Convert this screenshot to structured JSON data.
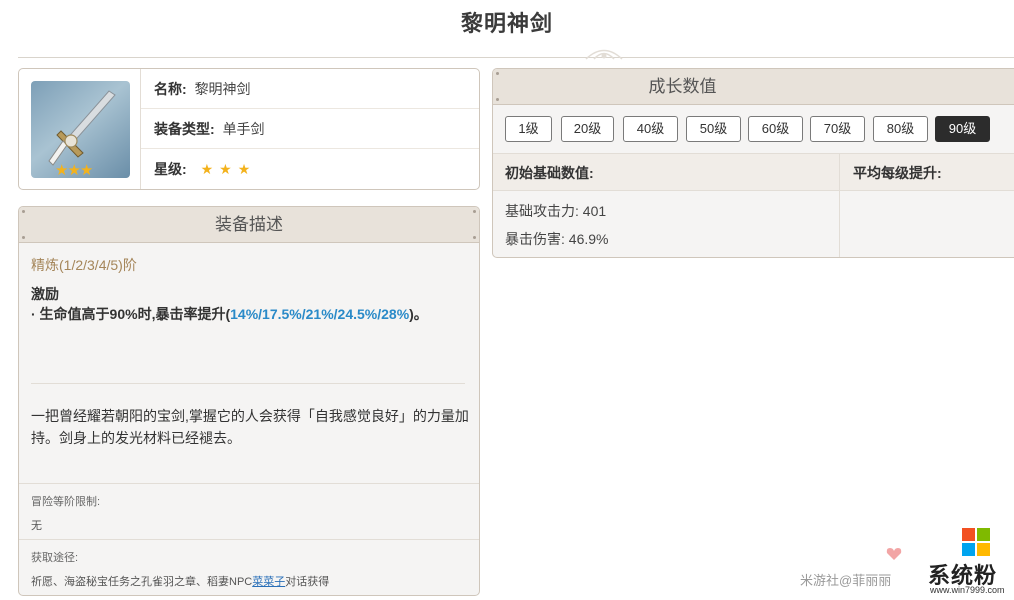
{
  "page": {
    "title": "黎明神剑"
  },
  "info": {
    "rows": [
      {
        "label": "名称:",
        "value": "黎明神剑"
      },
      {
        "label": "装备类型:",
        "value": "单手剑"
      },
      {
        "label": "星级:",
        "value": ""
      }
    ],
    "star_count": 3,
    "thumb_star_count": 3,
    "star_color": "#f3b21c"
  },
  "description": {
    "header": "装备描述",
    "refine": "精炼(1/2/3/4/5)阶",
    "passive_name": "激励",
    "passive_prefix": "· 生命值高于90%时,暴击率提升(",
    "passive_values": "14%/17.5%/21%/24.5%/28%",
    "passive_suffix": ")。",
    "lore": "一把曾经耀若朝阳的宝剑,掌握它的人会获得「自我感觉良好」的力量加持。剑身上的发光材料已经褪去。",
    "ascension_label": "冒险等阶限制:",
    "ascension_value": "无",
    "source_label": "获取途径:",
    "source_prefix": "祈愿、海盗秘宝任务之孔雀羽之章、稻妻NPC",
    "source_link": "菜菜子",
    "source_suffix": "对话获得",
    "highlight_color": "#2a8ac8"
  },
  "growth": {
    "header": "成长数值",
    "levels": [
      "1级",
      "20级",
      "40级",
      "50级",
      "60级",
      "70级",
      "80级",
      "90级"
    ],
    "active_level": "90级",
    "col_base": "初始基础数值:",
    "col_avg": "平均每级提升:",
    "stats": [
      "基础攻击力: 401",
      "暴击伤害: 46.9%"
    ]
  },
  "watermark": {
    "community": "米游社@菲丽丽",
    "brand": "系统粉",
    "url": "www.win7999.com",
    "logo_colors": [
      "#f25022",
      "#7fba00",
      "#00a4ef",
      "#ffb900"
    ]
  }
}
